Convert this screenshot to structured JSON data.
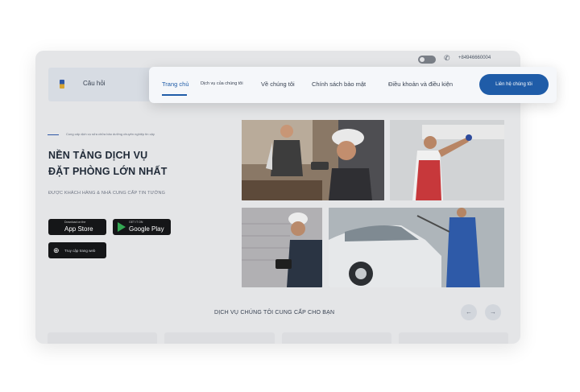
{
  "topbar": {
    "phone": "+84946660004"
  },
  "header": {
    "faq_label": "Câu hỏi"
  },
  "hero": {
    "kicker": "Cung cấp dịch vụ sửa chữa bảo dưỡng chuyên nghiệp tin cậy",
    "title_line1": "NỀN TẢNG DỊCH VỤ",
    "title_line2": "ĐẶT PHÒNG LỚN NHẤT",
    "subtitle": "ĐƯỢC KHÁCH HÀNG & NHÀ CUNG CẤP TIN TƯỞNG"
  },
  "stores": {
    "appstore": {
      "small": "Download on the",
      "label": "App Store"
    },
    "googleplay": {
      "small": "GET IT ON",
      "label": "Google Play"
    },
    "web": {
      "label": "Truy cập trang web"
    }
  },
  "section": {
    "title": "DỊCH VỤ CHÚNG TÔI CUNG CẤP CHO BẠN",
    "prev": "←",
    "next": "→"
  },
  "navbar": {
    "items": [
      {
        "label": "Trang chủ"
      },
      {
        "label": "Dịch vụ của chúng tôi"
      },
      {
        "label": "Về chúng tôi"
      },
      {
        "label": "Chính sách bảo mật"
      },
      {
        "label": "Điều khoản và điều kiện"
      }
    ],
    "cta": "Liên hệ chúng tôi"
  },
  "colors": {
    "primary": "#1f5ca8",
    "frame_bg": "#e4e5e7",
    "button_dark": "#151618"
  },
  "icons": [
    "toggle-icon",
    "phone-icon",
    "logo-icon",
    "apple-icon",
    "play-icon",
    "globe-icon",
    "arrow-left-icon",
    "arrow-right-icon"
  ]
}
